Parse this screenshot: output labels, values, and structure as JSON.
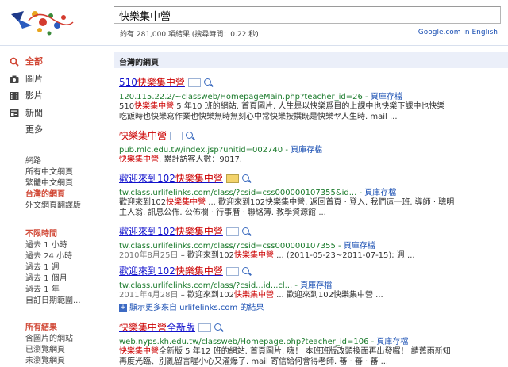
{
  "search": {
    "query": "快樂集中營"
  },
  "stats": "約有 281,000 項結果 (搜尋時間：0.22 秒)",
  "google_english": "Google.com in English",
  "sidebar": {
    "services": [
      {
        "label": "全部",
        "icon": "search-icon"
      },
      {
        "label": "圖片",
        "icon": "camera-icon"
      },
      {
        "label": "影片",
        "icon": "film-icon"
      },
      {
        "label": "新聞",
        "icon": "news-icon"
      },
      {
        "label": "更多",
        "icon": ""
      }
    ],
    "scope": [
      "網路",
      "所有中文網頁",
      "繁體中文網頁",
      "台灣的網頁",
      "外文網頁翻譯版"
    ],
    "time_heading": "不限時間",
    "time": [
      "過去 1 小時",
      "過去 24 小時",
      "過去 1 週",
      "過去 1 個月",
      "過去 1 年",
      "自訂日期範圍..."
    ],
    "results_heading": "所有結果",
    "results": [
      "含圖片的網站",
      "已瀏覽網頁",
      "未瀏覽網頁"
    ]
  },
  "section_title": "台灣的網頁",
  "results": [
    {
      "title_pre": "510",
      "title_em": "快樂集中營",
      "title_post": "",
      "url": "120.115.22.2/~classweb/HomepageMain.php?teacher_id=26",
      "sep": " - ",
      "cache": "頁庫存檔",
      "line1_pre": "510",
      "line1_em": "快樂集中營",
      "line1_post": " 5 年10 班的網站. 首頁圖片. 人生是以快樂爲目的上課中也快樂下課中也快樂",
      "line2": "吃飯時也快樂寫作業也快樂無時無刻心中常快樂按撰既是快樂ヤ人生時. mail ..."
    },
    {
      "title_pre": "",
      "title_em": "快樂集中營",
      "title_post": "",
      "url": "pub.mlc.edu.tw/index.jsp?unitid=002740",
      "sep": " - ",
      "cache": "頁庫存檔",
      "line1_pre": "",
      "line1_em": "快樂集中營",
      "line1_post": ". 累計訪客人數：9017.",
      "line2": ""
    },
    {
      "title_pre": "歡迎來到102",
      "title_em": "快樂集中營",
      "title_post": "",
      "url": "tw.class.urlifelinks.com/class/?csid=css000000107355&id...",
      "sep": " - ",
      "cache": "頁庫存檔",
      "line1_pre": "歡迎來到102",
      "line1_em": "快樂集中營",
      "line1_post": " ... 歡迎來到102快樂集中營. 返回首頁 · 登入. 我們這一班. 導師 · 聰明",
      "line2": "主人翁. 訊息公佈. 公佈欄 · 行事曆 · 聯絡簿. 教學資源館 ..."
    },
    {
      "title_pre": "歡迎來到102",
      "title_em": "快樂集中營",
      "title_post": "",
      "url": "tw.class.urlifelinks.com/class/?csid=css000000107355",
      "sep": " - ",
      "cache": "頁庫存檔",
      "date": "2010年8月25日",
      "line1_pre": " – 歡迎來到102",
      "line1_em": "快樂集中營",
      "line1_post": " ... (2011-05-23~2011-07-15); 週 ...",
      "line2": ""
    },
    {
      "title_pre": "歡迎來到102",
      "title_em": "快樂集中營",
      "title_post": "",
      "url": "tw.class.urlifelinks.com/class/?csid...id...cl...",
      "sep": " - ",
      "cache": "頁庫存檔",
      "date": "2011年4月28日",
      "line1_pre": " – 歡迎來到102",
      "line1_em": "快樂集中營",
      "line1_post": " ... 歡迎來到102快樂集中營 ...",
      "line2": ""
    },
    {
      "title_pre": "",
      "title_em": "快樂集中營",
      "title_post": "全新版",
      "url": "web.nyps.kh.edu.tw/classweb/Homepage.php?teacher_id=106",
      "sep": " - ",
      "cache": "頁庫存檔",
      "line1_pre": "",
      "line1_em": "快樂集中營",
      "line1_post": "全新版 5 年12 班的網站. 首頁圖片. 嗨！ 本班班版改頭換面再出發囉！ 請舊雨新知",
      "line2": "再度光臨、別亂留言喔小心又灌爆了. mail 寄信給何會得老師. 蕃 · 蕃 · 蕃 ..."
    }
  ],
  "more_results": "顯示更多來自 urlifelinks.com 的結果",
  "colors": {
    "accent_red": "#d14836",
    "link": "#1111cc",
    "url_green": "#1a7a2b"
  }
}
